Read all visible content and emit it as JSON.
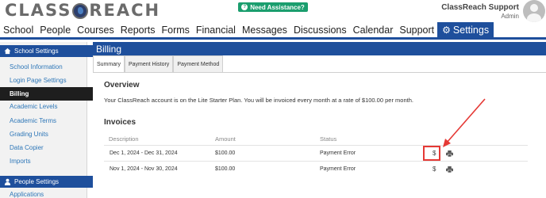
{
  "header": {
    "logo_text_left": "CLASS",
    "logo_text_right": "REACH",
    "assist_label": "Need Assistance?",
    "user_name": "ClassReach Support",
    "user_role": "Admin"
  },
  "nav": {
    "items": [
      "School",
      "People",
      "Courses",
      "Reports",
      "Forms",
      "Financial",
      "Messages",
      "Discussions",
      "Calendar",
      "Support",
      "Settings"
    ]
  },
  "sidebar": {
    "school_header": "School Settings",
    "items": [
      "School Information",
      "Login Page Settings",
      "Billing",
      "Academic Levels",
      "Academic Terms",
      "Grading Units",
      "Data Copier",
      "Imports"
    ],
    "people_header": "People Settings",
    "partial_item": "Applications"
  },
  "main": {
    "title": "Billing",
    "tabs": [
      "Summary",
      "Payment History",
      "Payment Method"
    ],
    "overview_title": "Overview",
    "overview_text": "Your ClassReach account is on the Lite Starter Plan. You will be invoiced every month at a rate of $100.00 per month.",
    "invoices_title": "Invoices",
    "columns": [
      "Description",
      "Amount",
      "Status"
    ],
    "rows": [
      {
        "description": "Dec 1, 2024 - Dec 31, 2024",
        "amount": "$100.00",
        "status": "Payment Error",
        "pay_symbol": "$"
      },
      {
        "description": "Nov 1, 2024 - Nov 30, 2024",
        "amount": "$100.00",
        "status": "Payment Error",
        "pay_symbol": "$"
      }
    ]
  },
  "colors": {
    "brand_blue": "#1e4f9c",
    "assist_green": "#1b9e6e",
    "link_blue": "#2e77b8",
    "annotation_red": "#e53935"
  }
}
